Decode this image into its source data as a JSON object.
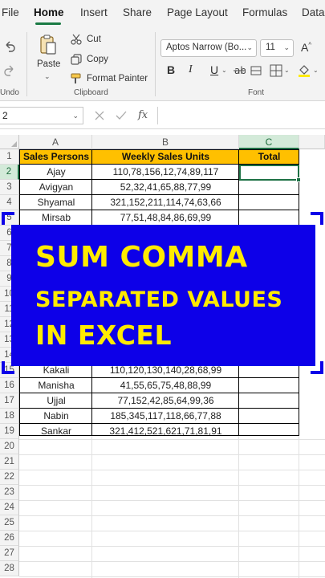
{
  "ribbon_tabs": [
    "File",
    "Home",
    "Insert",
    "Share",
    "Page Layout",
    "Formulas",
    "Data"
  ],
  "active_tab": "Home",
  "clipboard": {
    "undo_label": "Undo",
    "paste_label": "Paste",
    "cut_label": "Cut",
    "copy_label": "Copy",
    "format_painter_label": "Format Painter",
    "group_label": "Clipboard"
  },
  "font": {
    "font_name": "Aptos Narrow (Bo...",
    "font_size": "11",
    "group_label": "Font",
    "bold_glyph": "B",
    "italic_glyph": "I",
    "underline_glyph": "U"
  },
  "formula_bar": {
    "name_box_value": "2",
    "fx_label": "fx",
    "formula_value": ""
  },
  "columns": [
    "A",
    "B",
    "C"
  ],
  "selected_column": "C",
  "row_numbers": [
    "1",
    "2",
    "3",
    "4",
    "5",
    "6",
    "7",
    "8",
    "9",
    "10",
    "11",
    "12",
    "13",
    "14",
    "15",
    "16",
    "17",
    "18",
    "19",
    "20",
    "21",
    "22",
    "23",
    "24",
    "25",
    "26",
    "27",
    "28"
  ],
  "selected_row": "2",
  "table": {
    "headers": [
      "Sales Persons",
      "Weekly Sales Units",
      "Total"
    ],
    "rows_top": [
      {
        "name": "Ajay",
        "units": "110,78,156,12,74,89,117"
      },
      {
        "name": "Avigyan",
        "units": "52,32,41,65,88,77,99"
      },
      {
        "name": "Shyamal",
        "units": "321,152,211,114,74,63,66"
      },
      {
        "name": "Mirsab",
        "units": "77,51,48,84,86,69,99"
      }
    ],
    "rows_bottom": [
      {
        "name": "Kakali",
        "units": "110,120,130,140,28,68,99"
      },
      {
        "name": "Manisha",
        "units": "41,55,65,75,48,88,99"
      },
      {
        "name": "Ujjal",
        "units": "77,152,42,85,64,99,36"
      },
      {
        "name": "Nabin",
        "units": "185,345,117,118,66,77,88"
      },
      {
        "name": "Sankar",
        "units": "321,412,521,621,71,81,91"
      }
    ]
  },
  "overlay": {
    "line1": "SUM COMMA",
    "line2": "SEPARATED VALUES",
    "line3": "IN EXCEL",
    "background_color": "#0d00e8",
    "text_color": "#ffeb00"
  },
  "colors": {
    "header_fill": "#ffc000",
    "accent": "#1e7145"
  }
}
